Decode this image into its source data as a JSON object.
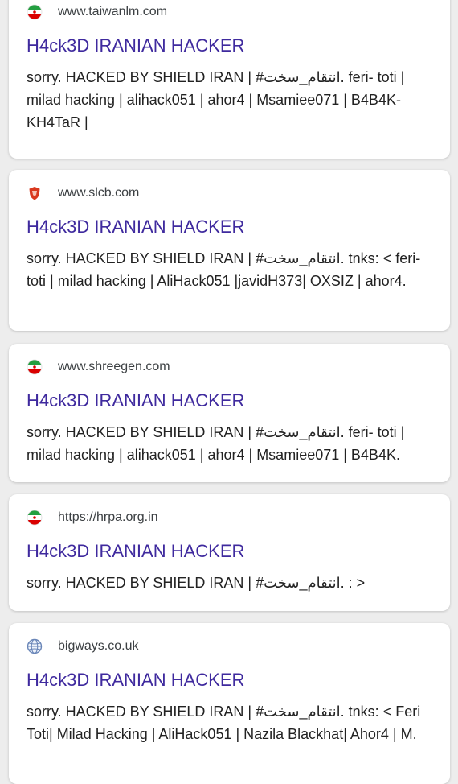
{
  "colors": {
    "page_background": "#ededed",
    "card_background": "#ffffff",
    "title_link": "#3f2a9e",
    "url_text": "#3c4043",
    "snippet_text": "#222222"
  },
  "results": [
    {
      "favicon": "iran-flag-icon",
      "url": "www.taiwanlm.com",
      "title": "H4ck3D IRANIAN HACKER",
      "snippet": "sorry. HACKED BY SHIELD IRAN | #انتقام_سخت. feri- toti | milad hacking | alihack051 | ahor4 | Msamiee071 | B4B4K-KH4TaR |"
    },
    {
      "favicon": "red-shield-icon",
      "url": "www.slcb.com",
      "title": "H4ck3D IRANIAN HACKER",
      "snippet": "sorry. HACKED BY SHIELD IRAN | #انتقام_سخت. tnks: < feri-toti | milad hacking | AliHack051 |javidH373| OXSIZ | ahor4."
    },
    {
      "favicon": "iran-flag-icon",
      "url": "www.shreegen.com",
      "title": "H4ck3D IRANIAN HACKER",
      "snippet": "sorry. HACKED BY SHIELD IRAN | #انتقام_سخت. feri- toti | milad hacking | alihack051 | ahor4 | Msamiee071 | B4B4K."
    },
    {
      "favicon": "iran-flag-icon",
      "url": "https://hrpa.org.in",
      "title": "H4ck3D IRANIAN HACKER",
      "snippet": "sorry. HACKED BY SHIELD IRAN | #انتقام_سخت. : >"
    },
    {
      "favicon": "globe-icon",
      "url": "bigways.co.uk",
      "title": "H4ck3D IRANIAN HACKER",
      "snippet": "sorry. HACKED BY SHIELD IRAN | #انتقام_سخت. tnks: < Feri Toti| Milad Hacking | AliHack051 | Nazila Blackhat| Ahor4 | M."
    }
  ]
}
